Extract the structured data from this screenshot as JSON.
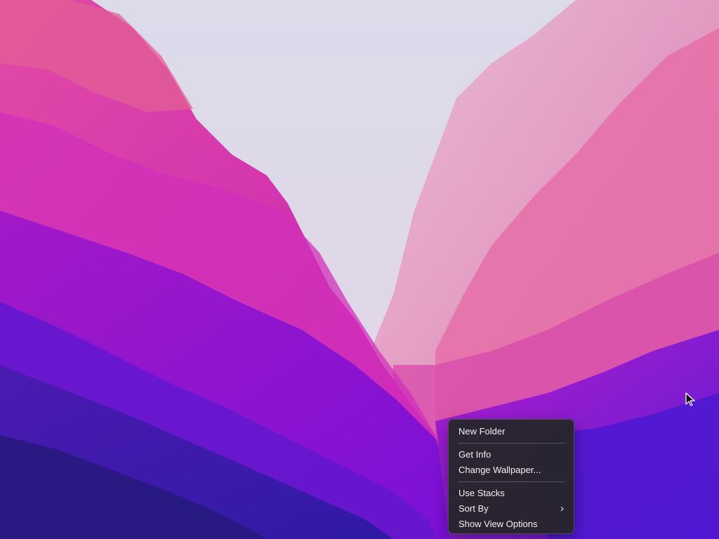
{
  "desktop": {
    "wallpaper": "macos-ventura-style-wallpaper"
  },
  "context_menu": {
    "items": [
      {
        "label": "New Folder"
      },
      {
        "label": "Get Info"
      },
      {
        "label": "Change Wallpaper..."
      },
      {
        "label": "Use Stacks"
      },
      {
        "label": "Sort By",
        "submenu_icon": "chevron-right-icon"
      },
      {
        "label": "Show View Options"
      }
    ]
  },
  "colors": {
    "menu_background": "#26242c",
    "menu_text": "#f2f2f2"
  },
  "cursor": {
    "icon": "mouse-pointer-icon"
  }
}
